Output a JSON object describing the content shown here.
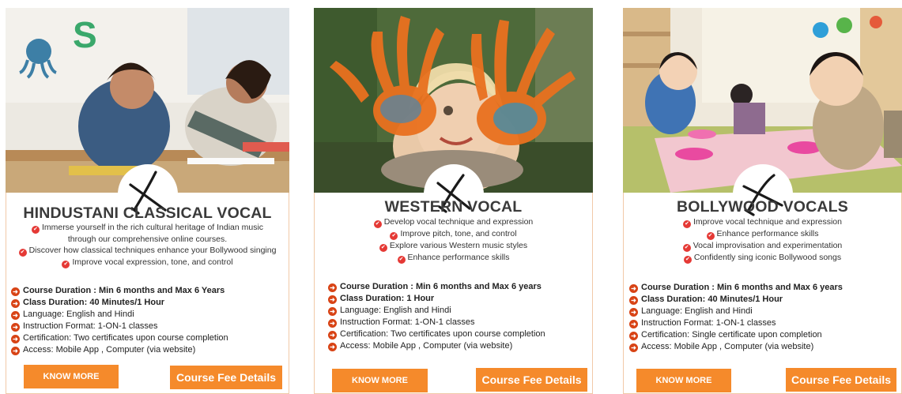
{
  "icons": {
    "tick": "check-circle-icon",
    "bullet": "arrow-circle-icon",
    "badge": "conductor-baton-icon"
  },
  "colors": {
    "accent": "#f58a2b",
    "check": "#e53935",
    "arrow": "#d84315",
    "border": "#f1c9a8"
  },
  "cards": [
    {
      "title": "HINDUSTANI CLASSICAL VOCAL",
      "features": [
        "Immerse yourself in the rich cultural heritage of Indian music",
        "through our comprehensive online courses.",
        "Discover how classical techniques enhance your Bollywood singing",
        "Improve vocal expression, tone, and control"
      ],
      "details": [
        "Course Duration : Min 6 months and Max 6 Years",
        "Class Duration: 40 Minutes/1 Hour",
        "Language: English and Hindi",
        "Instruction Format: 1-ON-1 classes",
        "Certification: Two certificates upon course completion",
        "Access: Mobile App , Computer (via website)"
      ],
      "know_more": "KNOW MORE",
      "fee": "Course Fee Details"
    },
    {
      "title": "WESTERN VOCAL",
      "features": [
        "Develop vocal technique and expression",
        "Improve pitch, tone, and control",
        "Explore various Western music styles",
        "Enhance performance skills"
      ],
      "details": [
        "Course Duration : Min 6 months and Max 6 years",
        "Class Duration: 1 Hour",
        "Language: English and Hindi",
        "Instruction Format: 1-ON-1 classes",
        "Certification: Two certificates upon course completion",
        "Access: Mobile App , Computer (via website)"
      ],
      "know_more": "KNOW MORE",
      "fee": "Course Fee Details"
    },
    {
      "title": "BOLLYWOOD VOCALS",
      "features": [
        "Improve vocal technique and expression",
        "Enhance performance skills",
        "Vocal improvisation and experimentation",
        "Confidently sing iconic Bollywood songs"
      ],
      "details": [
        "Course Duration : Min 6 months and Max 6 years",
        "Class Duration: 40 Minutes/1 Hour",
        "Language: English and Hindi",
        "Instruction Format: 1-ON-1 classes",
        "Certification: Single certificate upon completion",
        "Access: Mobile App , Computer (via website)"
      ],
      "know_more": "KNOW MORE",
      "fee": "Course Fee Details"
    }
  ]
}
